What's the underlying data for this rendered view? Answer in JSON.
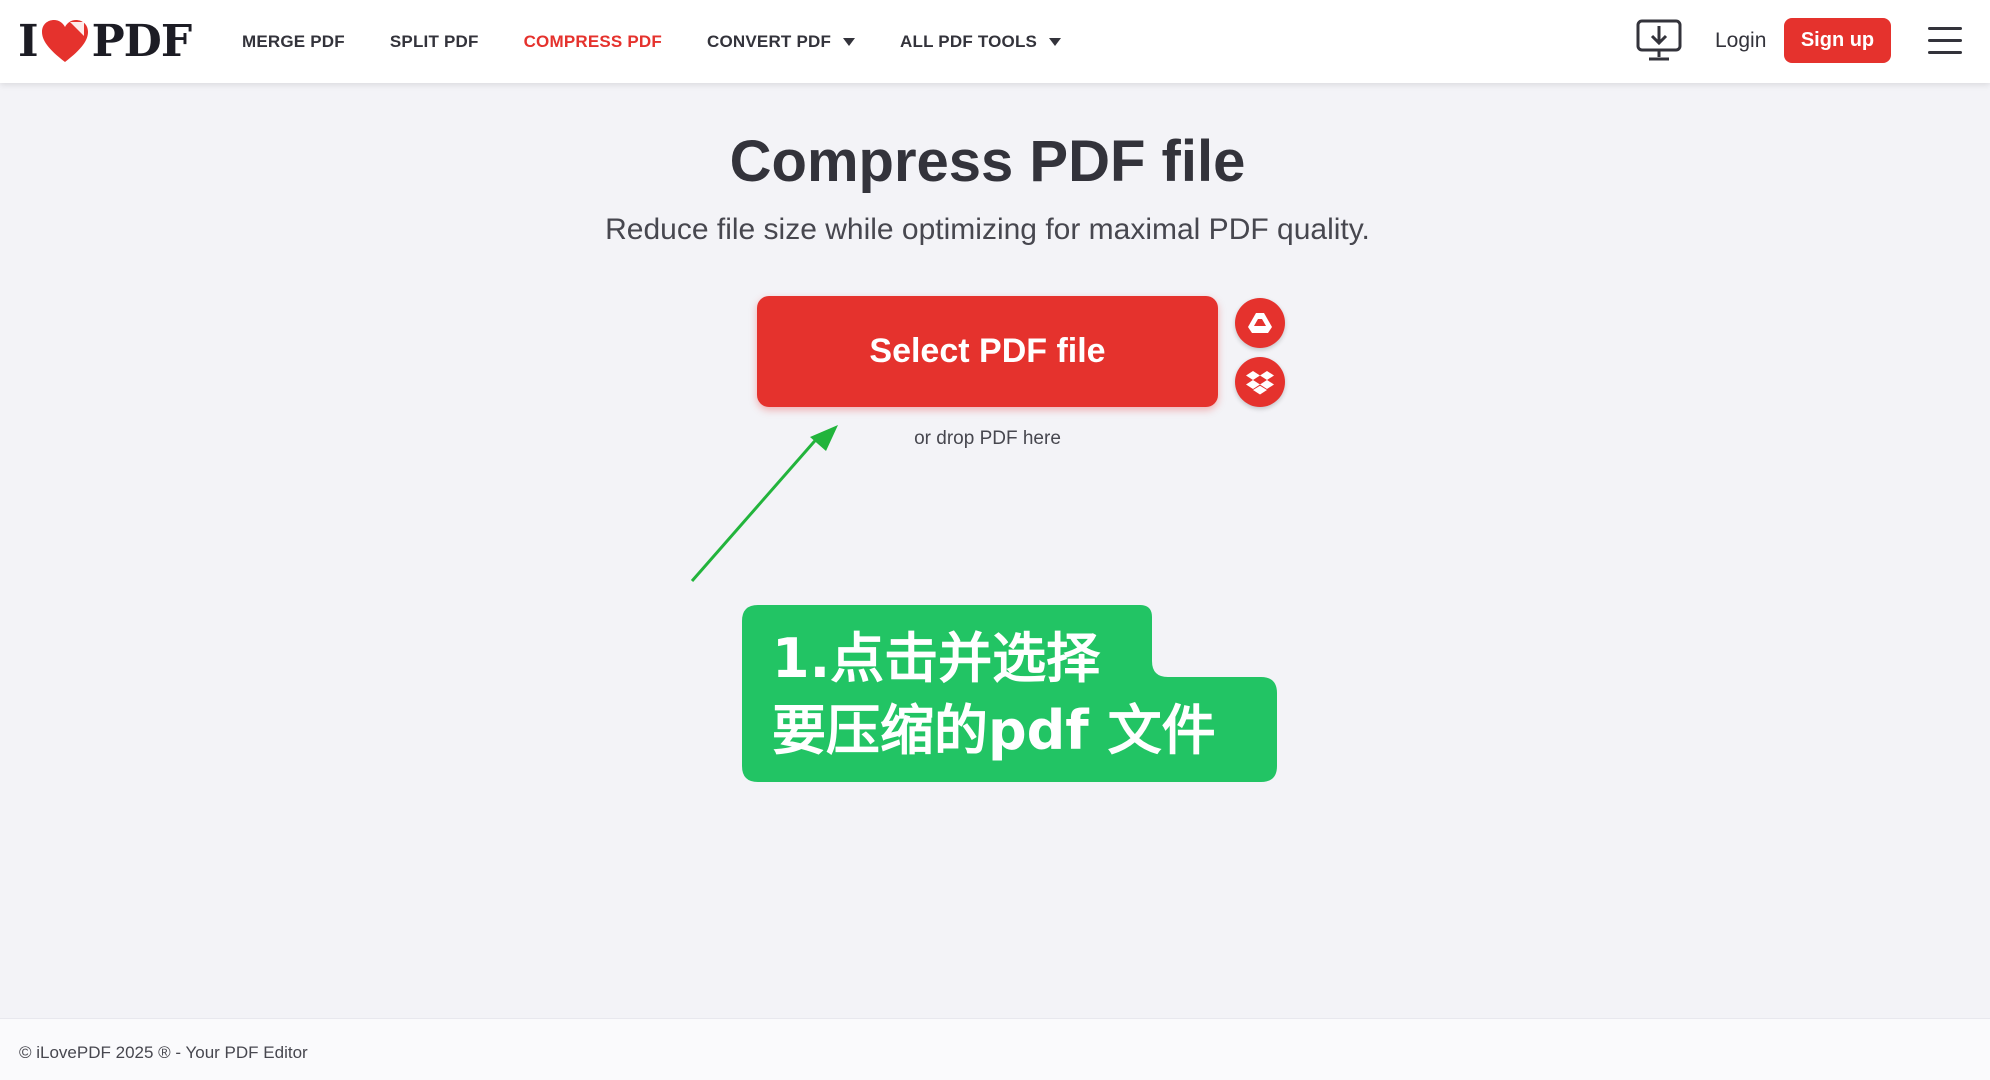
{
  "brand": {
    "logo_left": "I",
    "logo_right": "PDF",
    "accent_color": "#e5322d",
    "heart_icon": "heart-icon"
  },
  "nav": {
    "items": [
      {
        "label": "MERGE PDF",
        "active": false,
        "dropdown": false
      },
      {
        "label": "SPLIT PDF",
        "active": false,
        "dropdown": false
      },
      {
        "label": "COMPRESS PDF",
        "active": true,
        "dropdown": false
      },
      {
        "label": "CONVERT PDF",
        "active": false,
        "dropdown": true
      },
      {
        "label": "ALL PDF TOOLS",
        "active": false,
        "dropdown": true
      }
    ],
    "login_label": "Login",
    "signup_label": "Sign up",
    "desktop_icon": "desktop-download-icon",
    "menu_icon": "hamburger-menu-icon"
  },
  "main": {
    "title": "Compress PDF file",
    "subtitle": "Reduce file size while optimizing for maximal PDF quality.",
    "select_button_label": "Select PDF file",
    "drop_hint": "or drop PDF here",
    "cloud_buttons": [
      "google-drive-icon",
      "dropbox-icon"
    ]
  },
  "annotation": {
    "text": "1.点击并选择\n要压缩的pdf 文件",
    "color": "#22c464",
    "arrow_color": "#22b43c"
  },
  "footer": {
    "copyright": "© iLovePDF 2025 ® - Your PDF Editor"
  }
}
